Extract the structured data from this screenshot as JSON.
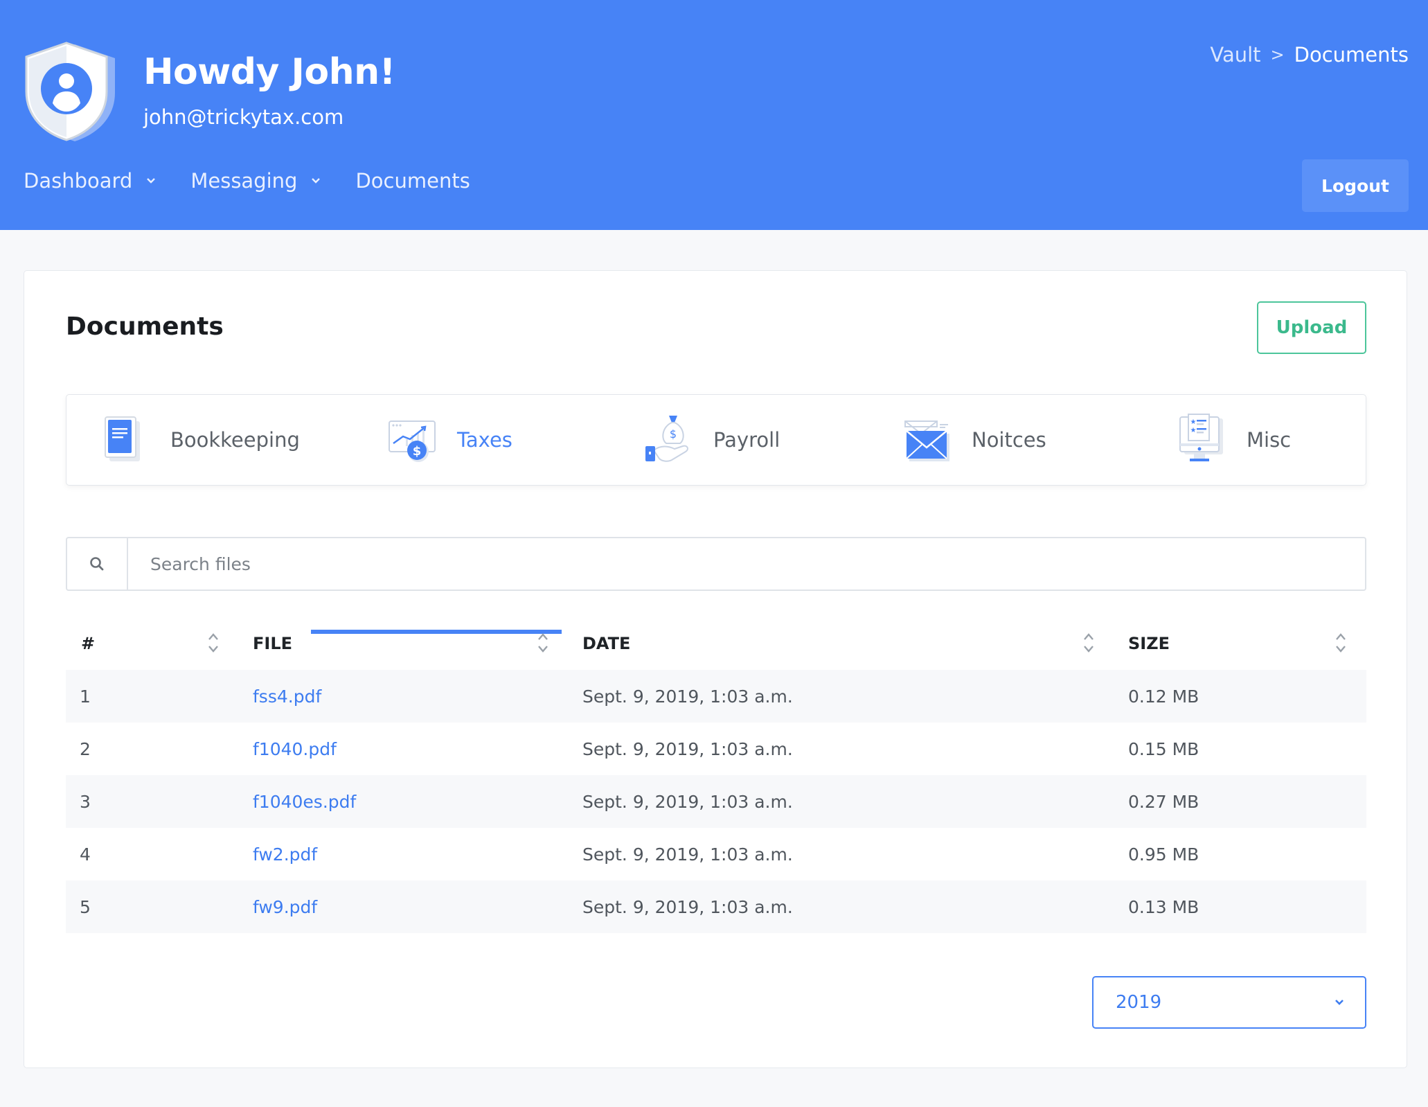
{
  "header": {
    "greeting": "Howdy John!",
    "email": "john@trickytax.com",
    "breadcrumb": {
      "root": "Vault",
      "separator": ">",
      "current": "Documents"
    },
    "nav": [
      {
        "label": "Dashboard",
        "has_dropdown": true
      },
      {
        "label": "Messaging",
        "has_dropdown": true
      },
      {
        "label": "Documents",
        "has_dropdown": false
      }
    ],
    "logout_label": "Logout",
    "colors": {
      "background": "#4783f6"
    }
  },
  "main": {
    "title": "Documents",
    "upload_label": "Upload",
    "tabs": [
      {
        "label": "Bookkeeping",
        "icon": "book-icon",
        "active": false
      },
      {
        "label": "Taxes",
        "icon": "tax-chart-icon",
        "active": true
      },
      {
        "label": "Payroll",
        "icon": "money-bag-hand-icon",
        "active": false
      },
      {
        "label": "Noitces",
        "icon": "envelope-icon",
        "active": false
      },
      {
        "label": "Misc",
        "icon": "monitor-form-icon",
        "active": false
      }
    ],
    "search": {
      "placeholder": "Search files",
      "value": "",
      "icon": "search-icon"
    },
    "table": {
      "columns": [
        "#",
        "FILE",
        "DATE",
        "SIZE"
      ],
      "rows": [
        {
          "num": "1",
          "file": "fss4.pdf",
          "date": "Sept. 9, 2019, 1:03 a.m.",
          "size": "0.12 MB"
        },
        {
          "num": "2",
          "file": "f1040.pdf",
          "date": "Sept. 9, 2019, 1:03 a.m.",
          "size": "0.15 MB"
        },
        {
          "num": "3",
          "file": "f1040es.pdf",
          "date": "Sept. 9, 2019, 1:03 a.m.",
          "size": "0.27 MB"
        },
        {
          "num": "4",
          "file": "fw2.pdf",
          "date": "Sept. 9, 2019, 1:03 a.m.",
          "size": "0.95 MB"
        },
        {
          "num": "5",
          "file": "fw9.pdf",
          "date": "Sept. 9, 2019, 1:03 a.m.",
          "size": "0.13 MB"
        }
      ]
    },
    "year_select": {
      "value": "2019"
    },
    "colors": {
      "accent": "#4783f6",
      "upload": "#3bb98c",
      "link": "#3d7cf0"
    }
  }
}
